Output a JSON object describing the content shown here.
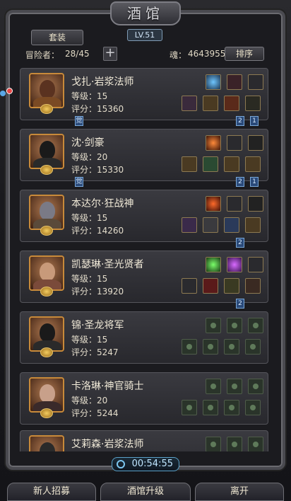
{
  "header": {
    "title": "酒馆",
    "level": "LV.51",
    "tab_set_label": "套装"
  },
  "stats": {
    "adventurer_label": "冒险者：",
    "adventurer_value": "28/45",
    "soul_label": "魂：",
    "soul_value": "4643955",
    "sort_label": "排序",
    "plus_label": "+"
  },
  "heroes": [
    {
      "name": "戈扎·岩浆法师",
      "level": "等级：15",
      "score": "评分：15360"
    },
    {
      "name": "沈·剑豪",
      "level": "等级：20",
      "score": "评分：15330"
    },
    {
      "name": "本达尔·狂战神",
      "level": "等级：15",
      "score": "评分：14260"
    },
    {
      "name": "凯瑟琳·圣光贤者",
      "level": "等级：15",
      "score": "评分：13920"
    },
    {
      "name": "锦·圣龙将军",
      "level": "等级：15",
      "score": "评分：5247"
    },
    {
      "name": "卡洛琳·神官骑士",
      "level": "等级：20",
      "score": "评分：5244"
    },
    {
      "name": "艾莉森·岩浆法师",
      "level": "",
      "score": ""
    }
  ],
  "badges": {
    "tag_2": "2",
    "tag_1": "1",
    "tag_awaken": "觉"
  },
  "timer": "00:54:55",
  "bottom": {
    "recruit": "新人招募",
    "upgrade": "酒馆升级",
    "leave": "离开"
  },
  "colors": {
    "accent_gold": "#c88a3a",
    "timer_blue": "#5aa0c8"
  }
}
